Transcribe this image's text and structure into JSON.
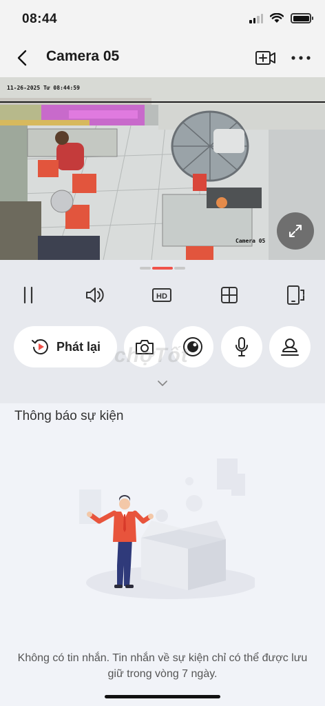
{
  "status_bar": {
    "time": "08:44",
    "icons": [
      "cellular-signal-icon",
      "wifi-icon",
      "battery-icon"
    ]
  },
  "nav": {
    "title": "Camera 05",
    "icons": [
      "back-chevron-icon",
      "add-video-camera-icon",
      "more-dots-icon"
    ]
  },
  "video": {
    "osd_timestamp": "11-26-2025 Tư  08:44:59",
    "osd_camera_name": "Camera 05"
  },
  "controls": {
    "icons": [
      "pause-icon",
      "speaker-icon",
      "hd-icon",
      "grid-icon",
      "rotate-screen-icon"
    ],
    "hd_label": "HD"
  },
  "actions": {
    "playback_label": "Phát lại",
    "icons": [
      "camera-icon",
      "record-icon",
      "microphone-icon",
      "person-icon"
    ],
    "watermark": "chợTốt"
  },
  "events": {
    "title": "Thông báo sự kiện",
    "empty_message": "Không có tin nhắn. Tin nhắn về sự kiện chỉ có thể được lưu giữ trong vòng 7 ngày."
  },
  "colors": {
    "accent": "#f0524b",
    "panel_bg": "#e7e9ee",
    "page_bg": "#f1f3f8"
  }
}
